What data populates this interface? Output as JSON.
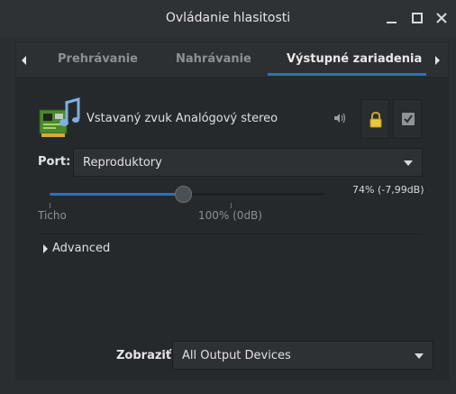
{
  "window": {
    "title": "Ovládanie hlasitosti"
  },
  "tabs": [
    {
      "label": "Prehrávanie"
    },
    {
      "label": "Nahrávanie"
    },
    {
      "label": "Výstupné zariadenia"
    }
  ],
  "active_tab": "Výstupné zariadenia",
  "device": {
    "name": "Vstavaný zvuk Analógový stereo",
    "port_label": "Port:",
    "port_value": "Reproduktory",
    "volume_percent": 74,
    "volume_text": "74% (-7,99dB)",
    "tick_min_label": "Ticho",
    "tick_100_label": "100% (0dB)"
  },
  "advanced": {
    "label": "Advanced"
  },
  "show": {
    "label": "Zobraziť:",
    "value": "All Output Devices"
  },
  "colors": {
    "accent": "#2f6fb3",
    "background": "#2b2e31",
    "panel": "#26292c"
  }
}
